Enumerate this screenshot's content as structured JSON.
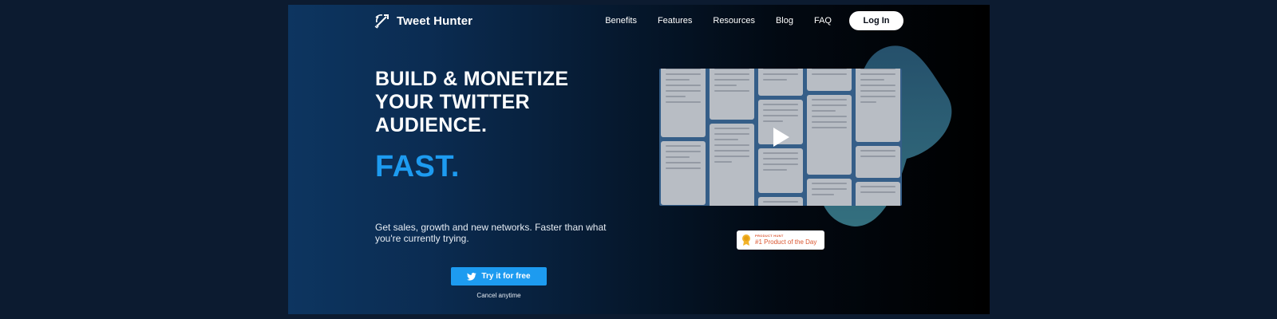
{
  "brand": {
    "name": "Tweet Hunter"
  },
  "nav": {
    "items": [
      "Benefits",
      "Features",
      "Resources",
      "Blog",
      "FAQ"
    ],
    "login_label": "Log In"
  },
  "hero": {
    "headline_lines": [
      "BUILD & MONETIZE",
      "YOUR TWITTER",
      "AUDIENCE."
    ],
    "accent_word": "FAST.",
    "subtitle": "Get sales, growth and new networks. Faster than what you're currently trying.",
    "cta_label": "Try it for free",
    "cta_note": "Cancel anytime"
  },
  "badge": {
    "small": "PRODUCT HUNT",
    "main": "#1 Product of the Day"
  },
  "icons": {
    "logo": "bow-arrow-icon",
    "cta": "twitter-bird-icon",
    "video": "play-icon",
    "badge": "medal-icon"
  },
  "colors": {
    "accent": "#1d9bf0",
    "page_bg": "#0c1b30",
    "badge_text": "#da552f",
    "blob": "#2a5a75"
  }
}
